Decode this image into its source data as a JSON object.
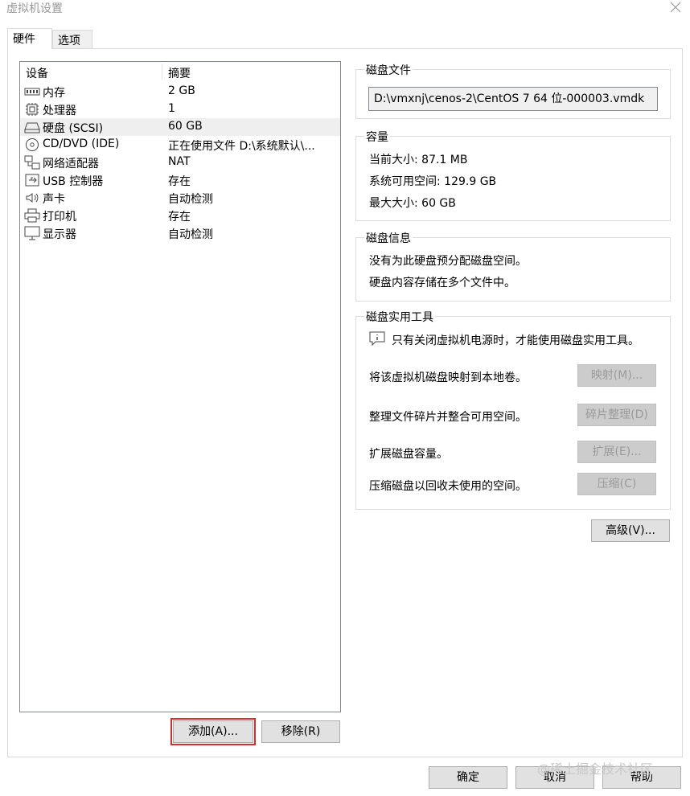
{
  "window": {
    "title": "虚拟机设置"
  },
  "tabs": [
    {
      "label": "硬件"
    },
    {
      "label": "选项"
    }
  ],
  "device_list": {
    "headers": {
      "device": "设备",
      "summary": "摘要"
    },
    "rows": [
      {
        "name": "内存",
        "summary": "2 GB",
        "icon": "memory-icon"
      },
      {
        "name": "处理器",
        "summary": "1",
        "icon": "processor-icon"
      },
      {
        "name": "硬盘 (SCSI)",
        "summary": "60 GB",
        "icon": "hard-disk-icon"
      },
      {
        "name": "CD/DVD (IDE)",
        "summary": "正在使用文件 D:\\系统默认\\...",
        "icon": "cd-dvd-icon"
      },
      {
        "name": "网络适配器",
        "summary": "NAT",
        "icon": "network-adapter-icon"
      },
      {
        "name": "USB 控制器",
        "summary": "存在",
        "icon": "usb-icon"
      },
      {
        "name": "声卡",
        "summary": "自动检测",
        "icon": "speaker-icon"
      },
      {
        "name": "打印机",
        "summary": "存在",
        "icon": "printer-icon"
      },
      {
        "name": "显示器",
        "summary": "自动检测",
        "icon": "monitor-icon"
      }
    ],
    "selected": "硬盘 (SCSI)"
  },
  "list_buttons": {
    "add": "添加(A)...",
    "remove": "移除(R)"
  },
  "disk_file": {
    "legend": "磁盘文件",
    "path": "D:\\vmxnj\\cenos-2\\CentOS 7 64 位-000003.vmdk"
  },
  "capacity": {
    "legend": "容量",
    "current": "当前大小: 87.1 MB",
    "available": "系统可用空间: 129.9 GB",
    "max": "最大大小: 60 GB"
  },
  "disk_info": {
    "legend": "磁盘信息",
    "line1": "没有为此硬盘预分配磁盘空间。",
    "line2": "硬盘内容存储在多个文件中。"
  },
  "disk_utilities": {
    "legend": "磁盘实用工具",
    "note": "只有关闭虚拟机电源时，才能使用磁盘实用工具。",
    "map_text": "将该虚拟机磁盘映射到本地卷。",
    "map_button": "映射(M)...",
    "defrag_text": "整理文件碎片并整合可用空间。",
    "defrag_button": "碎片整理(D)",
    "expand_text": "扩展磁盘容量。",
    "expand_button": "扩展(E)...",
    "compact_text": "压缩磁盘以回收未使用的空间。",
    "compact_button": "压缩(C)"
  },
  "advanced_button": "高级(V)...",
  "footer": {
    "ok": "确定",
    "cancel": "取消",
    "help": "帮助"
  },
  "watermark": "@稀土掘金技术社区"
}
